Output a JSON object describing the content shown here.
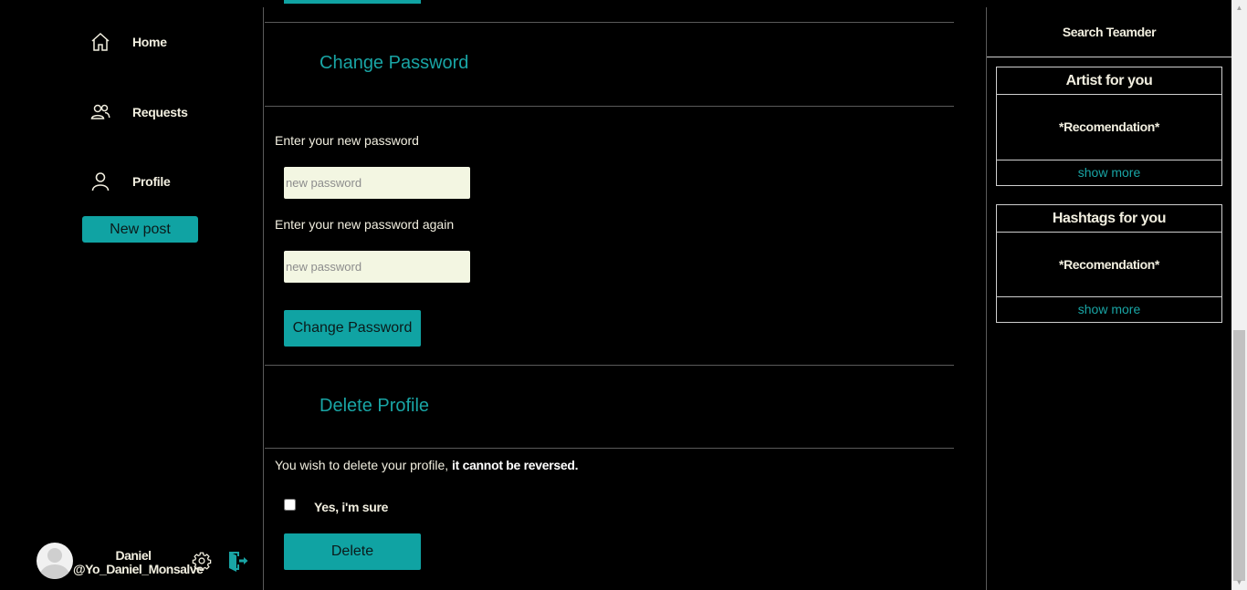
{
  "sidebar": {
    "nav": [
      {
        "label": "Home",
        "icon": "home-icon"
      },
      {
        "label": "Requests",
        "icon": "users-icon"
      },
      {
        "label": "Profile",
        "icon": "user-icon"
      }
    ],
    "new_post_label": "New post",
    "user": {
      "name": "Daniel",
      "handle": "@Yo_Daniel_Monsalve"
    }
  },
  "main": {
    "change_password": {
      "title": "Change Password",
      "label_new": "Enter your new password",
      "placeholder_new": "new password",
      "label_again": "Enter your new password again",
      "placeholder_again": "new password",
      "button_label": "Change Password"
    },
    "delete_profile": {
      "title": "Delete Profile",
      "warning_prefix": "You wish to delete your profile, ",
      "warning_bold": "it cannot be reversed.",
      "confirm_label": "Yes, i'm sure",
      "confirm_checked": false,
      "button_label": "Delete"
    }
  },
  "right_panel": {
    "search_label": "Search Teamder",
    "artist_box": {
      "title": "Artist for you",
      "recommendation": "*Recomendation*",
      "more": "show more"
    },
    "hashtag_box": {
      "title": "Hashtags for you",
      "recommendation": "*Recomendation*",
      "more": "show more"
    }
  },
  "colors": {
    "accent": "#10a3a3",
    "accent_text": "#19a5a5",
    "background": "#000000",
    "input_bg": "#f3f6e2"
  }
}
